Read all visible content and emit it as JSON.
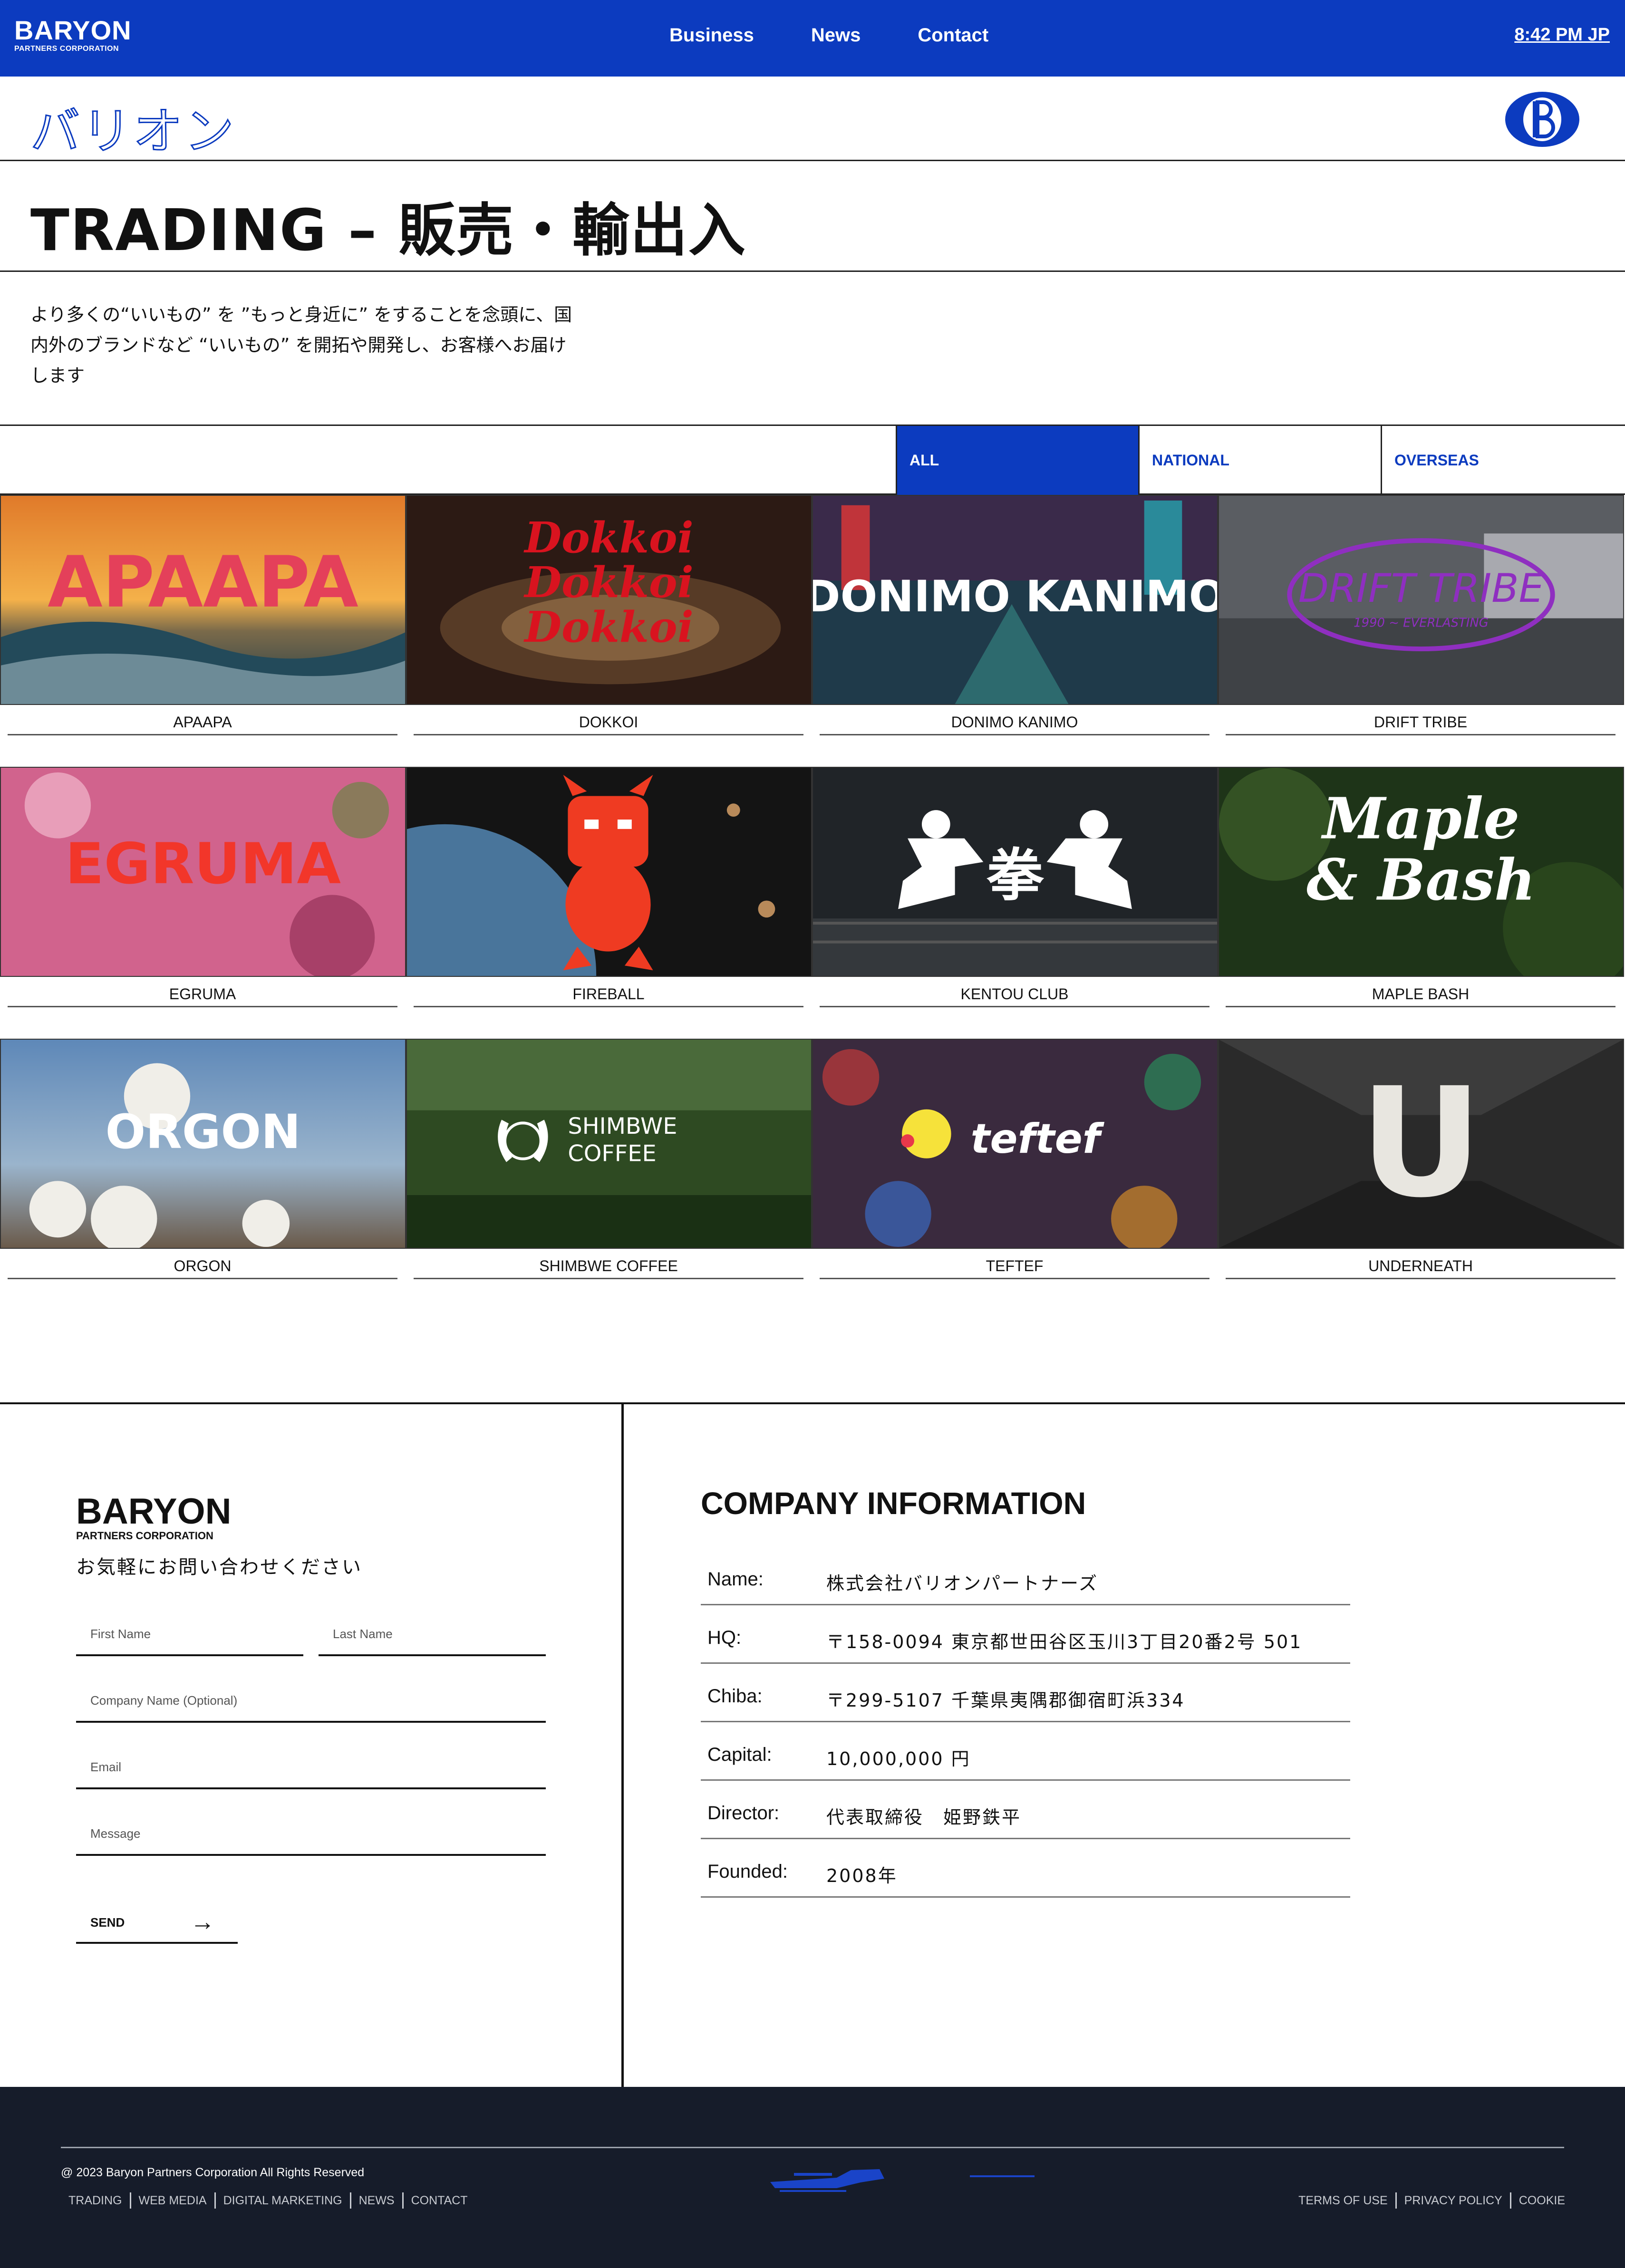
{
  "header": {
    "logo_big": "BARYON",
    "logo_small": "PARTNERS CORPORATION",
    "nav": [
      "Business",
      "News",
      "Contact"
    ],
    "clock": "8:42 PM JP",
    "bg_color": "#0c3bbf"
  },
  "brand": {
    "kana": "バリオン",
    "badge_icon": "baryon-b-icon"
  },
  "page": {
    "title": "TRADING – 販売・輸出入",
    "intro_lines": [
      "より多くの“いいもの” を ”もっと身近に” をすることを念頭に、国",
      "内外のブランドなど “いいもの” を開拓や開発し、お客様へお届け",
      "します"
    ]
  },
  "filters": {
    "items": [
      "ALL",
      "NATIONAL",
      "OVERSEAS"
    ],
    "active": "ALL"
  },
  "brands": [
    {
      "name": "APAAPA",
      "logo": "APAAPA"
    },
    {
      "name": "DOKKOI",
      "logo": "Dokkoi"
    },
    {
      "name": "DONIMO KANIMO",
      "logo": "DONIMO KANIMO"
    },
    {
      "name": "DRIFT TRIBE",
      "logo": "DRIFT TRIBE",
      "logo_sub": "1990 ~ EVERLASTING"
    },
    {
      "name": "EGRUMA",
      "logo": "EGRUMA"
    },
    {
      "name": "FIREBALL",
      "logo": ""
    },
    {
      "name": "KENTOU CLUB",
      "logo": "拳"
    },
    {
      "name": "MAPLE BASH",
      "logo": "Maple",
      "logo_sub": "& Bash"
    },
    {
      "name": "ORGON",
      "logo": "ORGON"
    },
    {
      "name": "SHIMBWE COFFEE",
      "logo": "SHIMBWE",
      "logo_sub": "COFFEE"
    },
    {
      "name": "TEFTEF",
      "logo": "teftef"
    },
    {
      "name": "UNDERNEATH",
      "logo": "U"
    }
  ],
  "contact": {
    "logo_big": "BARYON",
    "logo_small": "PARTNERS CORPORATION",
    "cta": "お気軽にお問い合わせください",
    "first_name": "First Name",
    "last_name": "Last Name",
    "company": "Company Name (Optional)",
    "email": "Email",
    "message": "Message",
    "send": "SEND"
  },
  "company": {
    "title": "COMPANY INFORMATION",
    "rows": [
      {
        "k": "Name:",
        "v": "株式会社バリオンパートナーズ"
      },
      {
        "k": "HQ:",
        "v": "〒158-0094 東京都世田谷区玉川3丁目20番2号 501"
      },
      {
        "k": "Chiba:",
        "v": "〒299-5107 千葉県夷隅郡御宿町浜334"
      },
      {
        "k": "Capital:",
        "v": "10,000,000 円"
      },
      {
        "k": "Director:",
        "v": "代表取締役　姫野鉄平"
      },
      {
        "k": "Founded:",
        "v": "2008年"
      }
    ]
  },
  "footer": {
    "copyright": "@ 2023 Baryon Partners Corporation All Rights Reserved",
    "links_left": [
      "TRADING",
      "WEB MEDIA",
      "DIGITAL MARKETING",
      "NEWS",
      "CONTACT"
    ],
    "links_right": [
      "TERMS OF USE",
      "PRIVACY POLICY",
      "COOKIE"
    ]
  }
}
